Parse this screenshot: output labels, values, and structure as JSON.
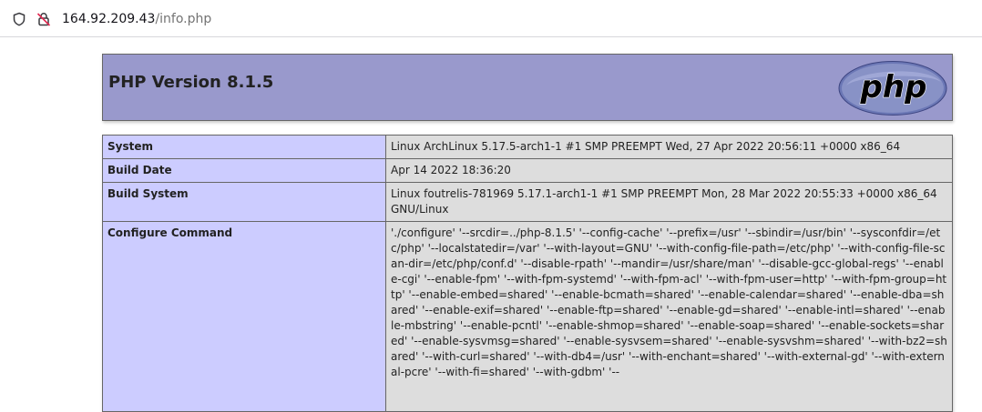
{
  "browser": {
    "url_host": "164.92.209.43",
    "url_path": "/info.php",
    "icons": [
      "shield-icon",
      "insecure-lock-icon"
    ]
  },
  "header": {
    "title": "PHP Version 8.1.5",
    "logo_text": "php"
  },
  "rows": [
    {
      "key": "System",
      "value": "Linux ArchLinux 5.17.5-arch1-1 #1 SMP PREEMPT Wed, 27 Apr 2022 20:56:11 +0000 x86_64"
    },
    {
      "key": "Build Date",
      "value": "Apr 14 2022 18:36:20"
    },
    {
      "key": "Build System",
      "value": "Linux foutrelis-781969 5.17.1-arch1-1 #1 SMP PREEMPT Mon, 28 Mar 2022 20:55:33 +0000 x86_64 GNU/Linux"
    },
    {
      "key": "Conﬁgure Command",
      "value": "'./conﬁgure' '--srcdir=../php-8.1.5' '--conﬁg-cache' '--preﬁx=/usr' '--sbindir=/usr/bin' '--sysconfdir=/etc/php' '--localstatedir=/var' '--with-layout=GNU' '--with-conﬁg-ﬁle-path=/etc/php' '--with-conﬁg-ﬁle-scan-dir=/etc/php/conf.d' '--disable-rpath' '--mandir=/usr/share/man' '--disable-gcc-global-regs' '--enable-cgi' '--enable-fpm' '--with-fpm-systemd' '--with-fpm-acl' '--with-fpm-user=http' '--with-fpm-group=http' '--enable-embed=shared' '--enable-bcmath=shared' '--enable-calendar=shared' '--enable-dba=shared' '--enable-exif=shared' '--enable-ftp=shared' '--enable-gd=shared' '--enable-intl=shared' '--enable-mbstring' '--enable-pcntl' '--enable-shmop=shared' '--enable-soap=shared' '--enable-sockets=shared' '--enable-sysvmsg=shared' '--enable-sysvsem=shared' '--enable-sysvshm=shared' '--with-bz2=shared' '--with-curl=shared' '--with-db4=/usr' '--with-enchant=shared' '--with-external-gd' '--with-external-pcre' '--with-ﬁ=shared' '--with-gdbm' '--"
    }
  ],
  "colors": {
    "header_bg": "#9999cc",
    "key_bg": "#ccccff",
    "value_bg": "#dddddd"
  }
}
